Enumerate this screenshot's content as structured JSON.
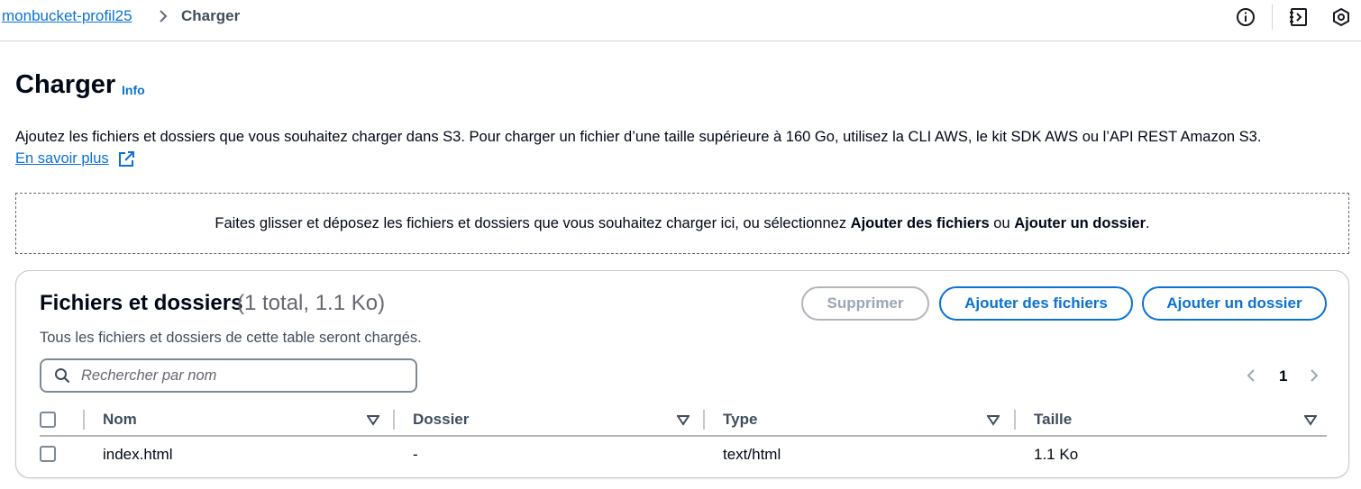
{
  "breadcrumb": {
    "bucket": "monbucket-profil25",
    "current": "Charger"
  },
  "header": {
    "title": "Charger",
    "info": "Info",
    "description": "Ajoutez les fichiers et dossiers que vous souhaitez charger dans S3. Pour charger un fichier d’une taille supérieure à 160 Go, utilisez la CLI AWS, le kit SDK AWS ou l’API REST Amazon S3.",
    "learn_more": "En savoir plus"
  },
  "dropzone": {
    "text_before": "Faites glisser et déposez les fichiers et dossiers que vous souhaitez charger ici, ou sélectionnez ",
    "add_files": "Ajouter des fichiers",
    "text_or": " ou ",
    "add_folder": "Ajouter un dossier",
    "text_end": "."
  },
  "files_panel": {
    "title": "Fichiers et dossiers",
    "count": "(1 total, 1.1 Ko)",
    "subtitle": "Tous les fichiers et dossiers de cette table seront chargés.",
    "buttons": {
      "delete": "Supprimer",
      "add_files": "Ajouter des fichiers",
      "add_folder": "Ajouter un dossier"
    },
    "search_placeholder": "Rechercher par nom",
    "page": "1",
    "columns": [
      "Nom",
      "Dossier",
      "Type",
      "Taille"
    ],
    "rows": [
      {
        "name": "index.html",
        "folder": "-",
        "type": "text/html",
        "size": "1.1 Ko"
      }
    ]
  },
  "icons": [
    "chevron-right-icon",
    "info-icon",
    "notes-icon",
    "settings-icon",
    "external-link-icon",
    "search-icon",
    "sort-icon"
  ],
  "colors": {
    "link": "#0972d3",
    "text": "#000716",
    "border": "#7d8998",
    "disabled": "#9ba7b6"
  }
}
